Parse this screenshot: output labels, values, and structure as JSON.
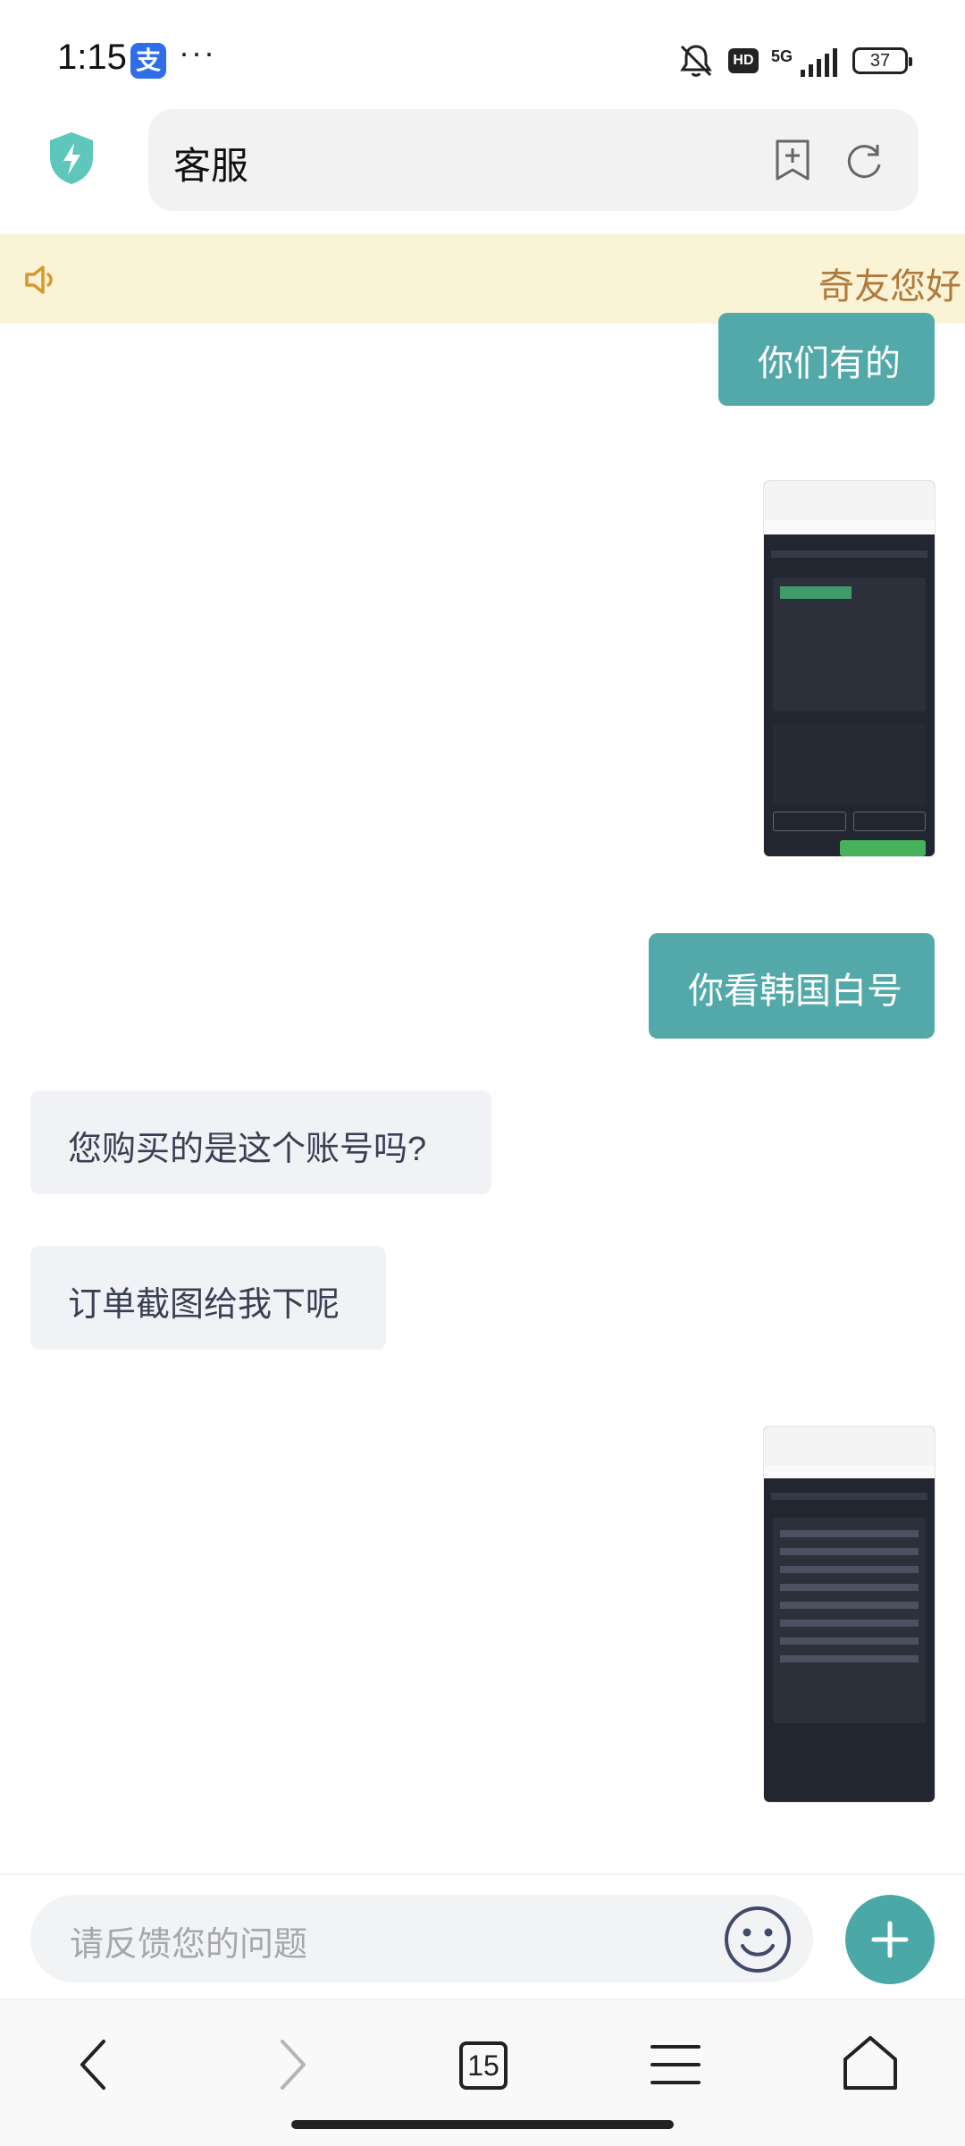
{
  "status_bar": {
    "time": "1:15",
    "alipay_badge": "支",
    "dots": "···",
    "hd": "HD",
    "network": "5G",
    "battery": "37"
  },
  "top_bar": {
    "title": "客服"
  },
  "notice": {
    "text": "奇友您好"
  },
  "messages": [
    {
      "side": "out",
      "text": "你们有的"
    },
    {
      "side": "out",
      "type": "image"
    },
    {
      "side": "out",
      "text": "你看韩国白号"
    },
    {
      "side": "in",
      "text": "您购买的是这个账号吗?"
    },
    {
      "side": "in",
      "text": "订单截图给我下呢"
    },
    {
      "side": "out",
      "type": "image"
    }
  ],
  "composer": {
    "placeholder": "请反馈您的问题"
  },
  "browser_nav": {
    "tab_count": "15"
  },
  "colors": {
    "accent": "#53a9a9",
    "notice_bg": "#faf3d6",
    "notice_text": "#b07a3c",
    "incoming_bg": "#f1f2f5"
  }
}
